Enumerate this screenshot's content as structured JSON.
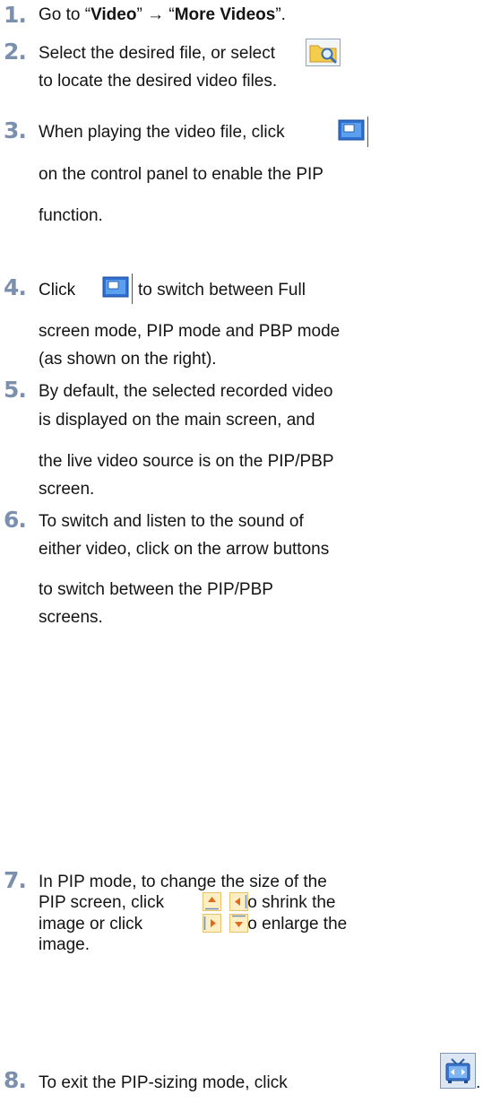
{
  "steps": [
    {
      "num": "1.",
      "pre": "Go to “",
      "b1": "Video",
      "mid": "” → “",
      "b2": "More Videos",
      "post": "”."
    },
    {
      "num": "2.",
      "l1": "Select the desired file, or select",
      "l2": "to locate the desired video files."
    },
    {
      "num": "3.",
      "l1": "When playing the video file, click",
      "l2": "on the control panel to enable the PIP",
      "l3": "function."
    },
    {
      "num": "4.",
      "l1a": "Click",
      "l1b": "to switch between Full",
      "l2": "screen mode, PIP mode and PBP mode",
      "l3": "(as shown on the right)."
    },
    {
      "num": "5.",
      "l1": "By default, the selected recorded video",
      "l2": "is displayed on the main screen, and",
      "l3": "the live video source is on the PIP/PBP",
      "l4": "screen."
    },
    {
      "num": "6.",
      "l1": "To switch and listen to the sound of",
      "l2": "either video, click on the arrow buttons",
      "l3": "to switch between the PIP/PBP",
      "l4": "screens."
    },
    {
      "num": "7.",
      "l1": "In PIP mode, to change the size of the",
      "l2a": "PIP screen, click",
      "l2b": "to shrink the",
      "l3a": "image or click",
      "l3b": "to enlarge the",
      "l4": "image."
    },
    {
      "num": "8.",
      "l1": "To exit the PIP-sizing mode, click",
      "l1end": "."
    }
  ],
  "icons": {
    "browse": "folder-search-icon",
    "pip": "pip-mode-icon",
    "shrink_up": "arrow-up-icon",
    "shrink_left": "arrow-left-icon",
    "enlarge_right": "arrow-right-icon",
    "enlarge_down": "arrow-down-icon",
    "exit": "exit-pip-sizing-icon"
  },
  "colors": {
    "step_number": "#7b8fae",
    "text": "#141414"
  }
}
